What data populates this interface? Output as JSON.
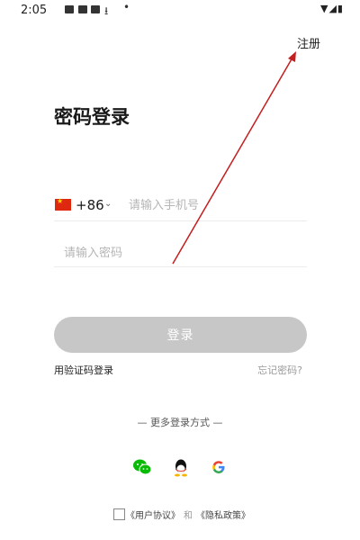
{
  "status_bar": {
    "time": "2:05",
    "download_glyph": "⭳",
    "dot_glyph": "•",
    "right_glyphs": "▼◢▮"
  },
  "header": {
    "register_label": "注册"
  },
  "title": "密码登录",
  "phone": {
    "country_code": "+86",
    "chevron": "⌄",
    "placeholder": "请输入手机号"
  },
  "password": {
    "placeholder": "请输入密码"
  },
  "login_button": "登录",
  "links": {
    "code_login": "用验证码登录",
    "forgot_password": "忘记密码?"
  },
  "more_methods": "— 更多登录方式 —",
  "social_icons": [
    "wechat-icon",
    "qq-icon",
    "google-icon"
  ],
  "agreement": {
    "user_agreement": "《用户协议》",
    "and": "和",
    "privacy_policy": "《隐私政策》"
  },
  "colors": {
    "annotation_arrow": "#c41e1e",
    "button_disabled": "#c7c7c7",
    "wechat": "#09bb07",
    "google_blue": "#4285f4",
    "flag_red": "#de2910"
  }
}
